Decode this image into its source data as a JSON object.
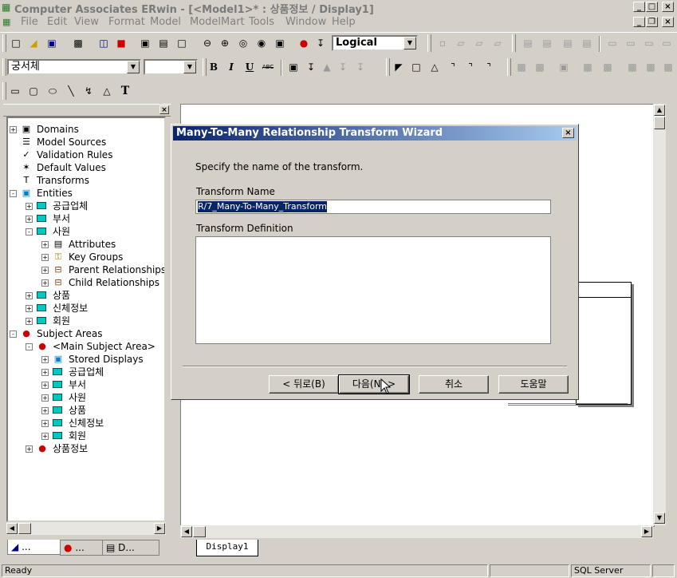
{
  "app": {
    "title": "Computer Associates ERwin - [<Model1>* : 상품정보 / Display1]"
  },
  "menu": [
    "File",
    "Edit",
    "View",
    "Format",
    "Model",
    "ModelMart",
    "Tools",
    "Window",
    "Help"
  ],
  "toolbar": {
    "view_level": "Logical",
    "font_name": "궁서체",
    "font_size": "",
    "bold": "B",
    "italic": "I",
    "underline": "U",
    "strike": "ABC",
    "text_tool": "T"
  },
  "tree": {
    "nodes": [
      {
        "label": "Domains",
        "icon": "domains-icon"
      },
      {
        "label": "Model Sources",
        "icon": "model-sources-icon"
      },
      {
        "label": "Validation Rules",
        "icon": "validation-rules-icon"
      },
      {
        "label": "Default Values",
        "icon": "default-values-icon"
      },
      {
        "label": "Transforms",
        "icon": "transforms-icon"
      },
      {
        "label": "Entities",
        "icon": "entities-icon"
      },
      {
        "label": "공급업체",
        "icon": "entity-icon"
      },
      {
        "label": "부서",
        "icon": "entity-icon"
      },
      {
        "label": "사원",
        "icon": "entity-icon"
      },
      {
        "label": "Attributes",
        "icon": "attributes-icon"
      },
      {
        "label": "Key Groups",
        "icon": "key-groups-icon"
      },
      {
        "label": "Parent Relationships",
        "icon": "relationship-icon"
      },
      {
        "label": "Child Relationships",
        "icon": "relationship-icon"
      },
      {
        "label": "상품",
        "icon": "entity-icon"
      },
      {
        "label": "신체정보",
        "icon": "entity-icon"
      },
      {
        "label": "회원",
        "icon": "entity-icon"
      },
      {
        "label": "Subject Areas",
        "icon": "subject-area-icon"
      },
      {
        "label": "<Main Subject Area>",
        "icon": "subject-area-icon"
      },
      {
        "label": "Stored Displays",
        "icon": "stored-displays-icon"
      },
      {
        "label": "공급업체",
        "icon": "entity-icon"
      },
      {
        "label": "부서",
        "icon": "entity-icon"
      },
      {
        "label": "사원",
        "icon": "entity-icon"
      },
      {
        "label": "상품",
        "icon": "entity-icon"
      },
      {
        "label": "신체정보",
        "icon": "entity-icon"
      },
      {
        "label": "회원",
        "icon": "entity-icon"
      },
      {
        "label": "상품정보",
        "icon": "subject-area-icon"
      }
    ],
    "tabs": [
      "...",
      "...",
      "D..."
    ]
  },
  "canvas": {
    "tab": "Display1"
  },
  "dialog": {
    "title": "Many-To-Many Relationship Transform Wizard",
    "instruction": "Specify the name of the transform.",
    "name_label": "Transform Name",
    "name_value": "R/7_Many-To-Many_Transform",
    "definition_label": "Transform Definition",
    "definition_value": "",
    "back_button": "< 뒤로(B)",
    "next_button": "다음(N) >",
    "cancel_button": "취소",
    "help_button": "도움말"
  },
  "status": {
    "ready": "Ready",
    "db": "SQL Server"
  }
}
